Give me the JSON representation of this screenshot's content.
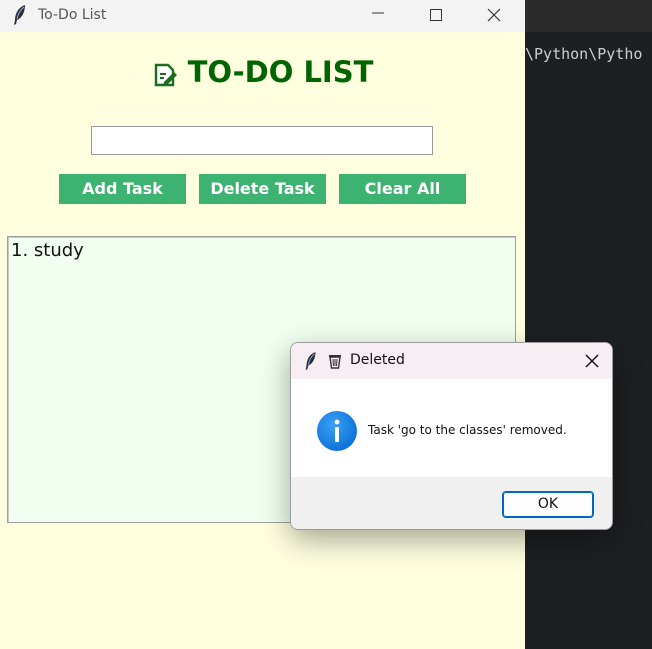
{
  "terminal": {
    "path_text": "\\Python\\Pytho"
  },
  "main_window": {
    "title": "To-Do List",
    "heading": "TO-DO LIST",
    "task_input": {
      "value": "",
      "placeholder": ""
    },
    "buttons": {
      "add": "Add Task",
      "delete": "Delete Task",
      "clear": "Clear All"
    },
    "tasks": [
      "1. study"
    ]
  },
  "dialog": {
    "title": "Deleted",
    "message": "Task 'go to the classes' removed.",
    "ok_label": "OK",
    "icons": [
      "feather-icon",
      "wastebasket-icon",
      "info-icon",
      "close-icon"
    ]
  },
  "colors": {
    "window_bg": "#ffffe0",
    "heading": "#006400",
    "button_bg": "#3cb371",
    "list_bg": "#f0fff0",
    "info_blue": "#1a73e8"
  }
}
